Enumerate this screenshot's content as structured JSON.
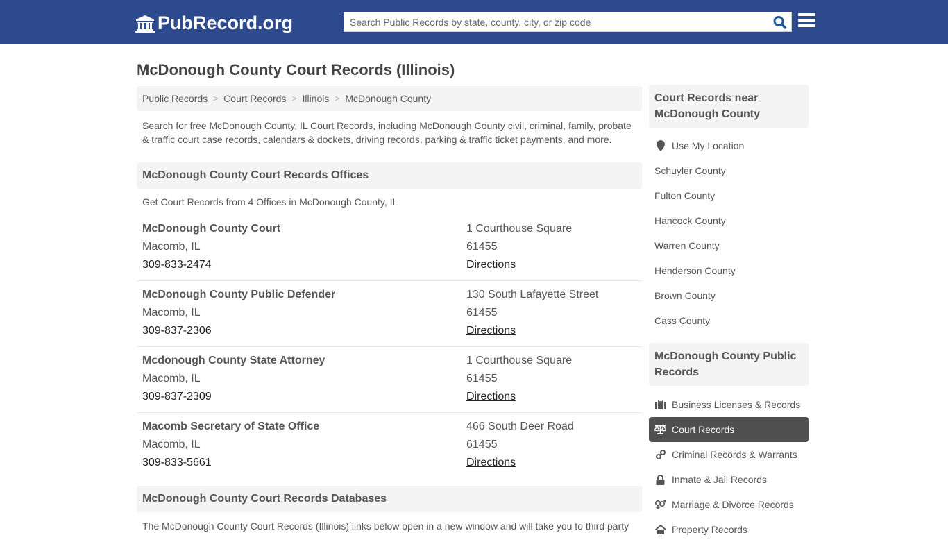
{
  "header": {
    "logo_text": "PubRecord.org",
    "search_placeholder": "Search Public Records by state, county, city, or zip code",
    "search_value": ""
  },
  "page_title": "McDonough County Court Records (Illinois)",
  "breadcrumb": [
    "Public Records",
    "Court Records",
    "Illinois",
    "McDonough County"
  ],
  "breadcrumb_separator": ">",
  "intro": "Search for free McDonough County, IL Court Records, including McDonough County civil, criminal, family, probate & traffic court case records, calendars & dockets, driving records, parking & traffic ticket payments, and more.",
  "offices": {
    "heading": "McDonough County Court Records Offices",
    "subheading": "Get Court Records from 4 Offices in McDonough County, IL",
    "directions_label": "Directions",
    "items": [
      {
        "name": "McDonough County Court",
        "city": "Macomb, IL",
        "phone": "309-833-2474",
        "address": "1 Courthouse Square",
        "zip": "61455"
      },
      {
        "name": "McDonough County Public Defender",
        "city": "Macomb, IL",
        "phone": "309-837-2306",
        "address": "130 South Lafayette Street",
        "zip": "61455"
      },
      {
        "name": "Mcdonough County State Attorney",
        "city": "Macomb, IL",
        "phone": "309-837-2309",
        "address": "1 Courthouse Square",
        "zip": "61455"
      },
      {
        "name": "Macomb Secretary of State Office",
        "city": "Macomb, IL",
        "phone": "309-833-5661",
        "address": "466 South Deer Road",
        "zip": "61455"
      }
    ]
  },
  "databases": {
    "heading": "McDonough County Court Records Databases",
    "intro": "The McDonough County Court Records (Illinois) links below open in a new window and will take you to third party"
  },
  "sidebar": {
    "nearby_heading": "Court Records near McDonough County",
    "use_location": "Use My Location",
    "nearby": [
      "Schuyler County",
      "Fulton County",
      "Hancock County",
      "Warren County",
      "Henderson County",
      "Brown County",
      "Cass County"
    ],
    "public_heading": "McDonough County Public Records",
    "categories": [
      {
        "label": "Business Licenses & Records",
        "icon": "briefcase-icon",
        "active": false
      },
      {
        "label": "Court Records",
        "icon": "scales-icon",
        "active": true
      },
      {
        "label": "Criminal Records & Warrants",
        "icon": "handcuffs-icon",
        "active": false
      },
      {
        "label": "Inmate & Jail Records",
        "icon": "lock-icon",
        "active": false
      },
      {
        "label": "Marriage & Divorce Records",
        "icon": "gender-icon",
        "active": false
      },
      {
        "label": "Property Records",
        "icon": "home-icon",
        "active": false
      }
    ]
  },
  "colors": {
    "header_bg": "#2e4a8e",
    "search_icon": "#1a5a9a",
    "active_item_bg": "#4f4f4f"
  }
}
